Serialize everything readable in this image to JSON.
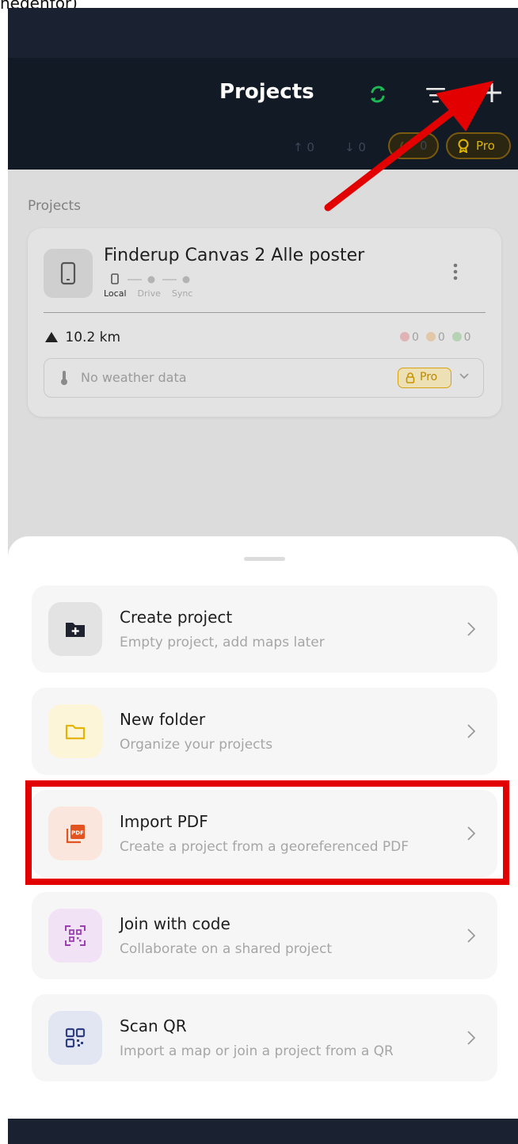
{
  "caption": "nedenfor)",
  "header": {
    "title": "Projects",
    "upload_count": "↑ 0",
    "download_count": "↓ 0",
    "live_count": "0",
    "pro_label": "Pro"
  },
  "projects": {
    "section_label": "Projects",
    "card": {
      "name": "Finderup Canvas 2 Alle poster",
      "steps": [
        "Local",
        "Drive",
        "Sync"
      ],
      "distance": "10.2 km",
      "counters": [
        "0",
        "0",
        "0"
      ],
      "weather": "No weather data",
      "weather_pro": "Pro"
    }
  },
  "sheet": {
    "options": [
      {
        "title": "Create project",
        "subtitle": "Empty project, add maps later"
      },
      {
        "title": "New folder",
        "subtitle": "Organize your projects"
      },
      {
        "title": "Import PDF",
        "subtitle": "Create a project from a georeferenced PDF"
      },
      {
        "title": "Join with code",
        "subtitle": "Collaborate on a shared project"
      },
      {
        "title": "Scan QR",
        "subtitle": "Import a map or join a project from a QR"
      }
    ]
  },
  "colors": {
    "header_bg": "#121a26",
    "sync_green": "#1db954",
    "pro_gold": "#e0b500",
    "annotation_red": "#e20000"
  },
  "icons": [
    "sync-icon",
    "filter-icon",
    "plus-icon",
    "crown-icon",
    "phone-icon",
    "kebab-icon",
    "mountain-icon",
    "thermometer-icon",
    "lock-icon",
    "chevron-down-icon",
    "folder-plus-icon",
    "folder-icon",
    "pdf-icon",
    "code-icon",
    "qr-icon",
    "chevron-right-icon"
  ]
}
